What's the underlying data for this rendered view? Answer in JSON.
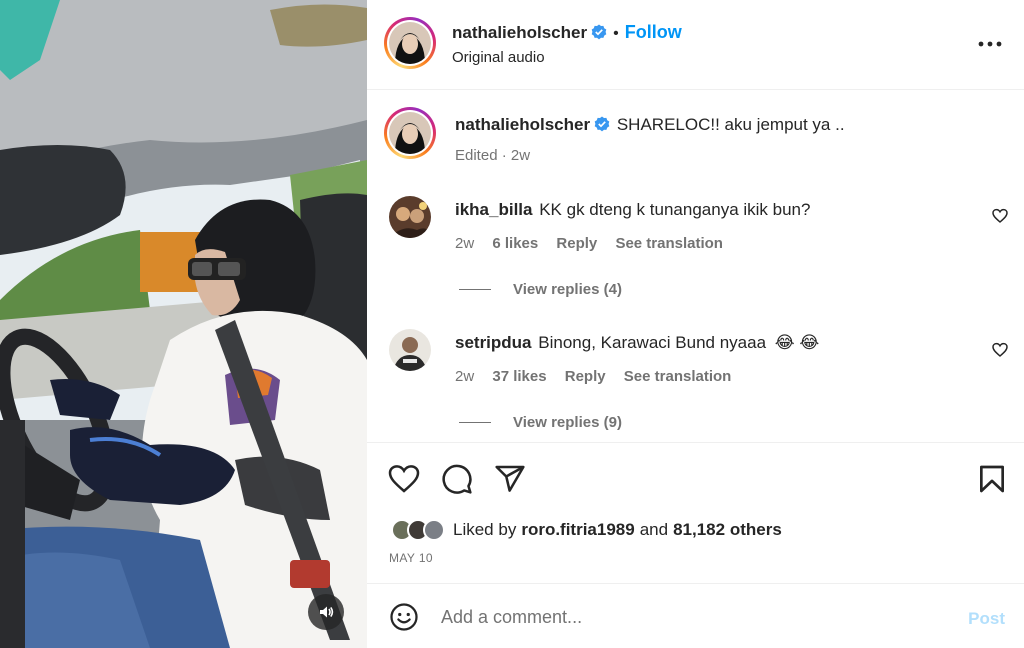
{
  "post": {
    "username": "nathalieholscher",
    "follow_label": "Follow",
    "separator": "•",
    "audio": "Original audio"
  },
  "caption": {
    "username": "nathalieholscher",
    "text": "SHARELOC!! aku jemput ya ..",
    "edited": "Edited",
    "time": "2w"
  },
  "comments": [
    {
      "username": "ikha_billa",
      "text": "KK gk dteng k tunanganya ikik bun?",
      "time": "2w",
      "likes": "6 likes",
      "reply": "Reply",
      "translate": "See translation",
      "view_replies": "View replies (4)"
    },
    {
      "username": "setripdua",
      "text": "Binong, Karawaci Bund nyaaa",
      "emoji": "😂 😂",
      "time": "2w",
      "likes": "37 likes",
      "reply": "Reply",
      "translate": "See translation",
      "view_replies": "View replies (9)"
    }
  ],
  "likes": {
    "prefix": "Liked by",
    "user": "roro.fitria1989",
    "and": "and",
    "others": "81,182 others"
  },
  "date": "MAY 10",
  "compose": {
    "placeholder": "Add a comment...",
    "post_label": "Post"
  },
  "icons": {
    "verified": "verified-badge-icon",
    "more": "more-options-icon",
    "heart": "heart-icon",
    "comment": "comment-icon",
    "share": "share-icon",
    "save": "bookmark-icon",
    "emoji": "emoji-icon",
    "mute": "speaker-icon"
  },
  "colors": {
    "accent": "#0095f6",
    "post_disabled": "#b2dffc",
    "muted_text": "#737373",
    "verified": "#3897f0"
  }
}
